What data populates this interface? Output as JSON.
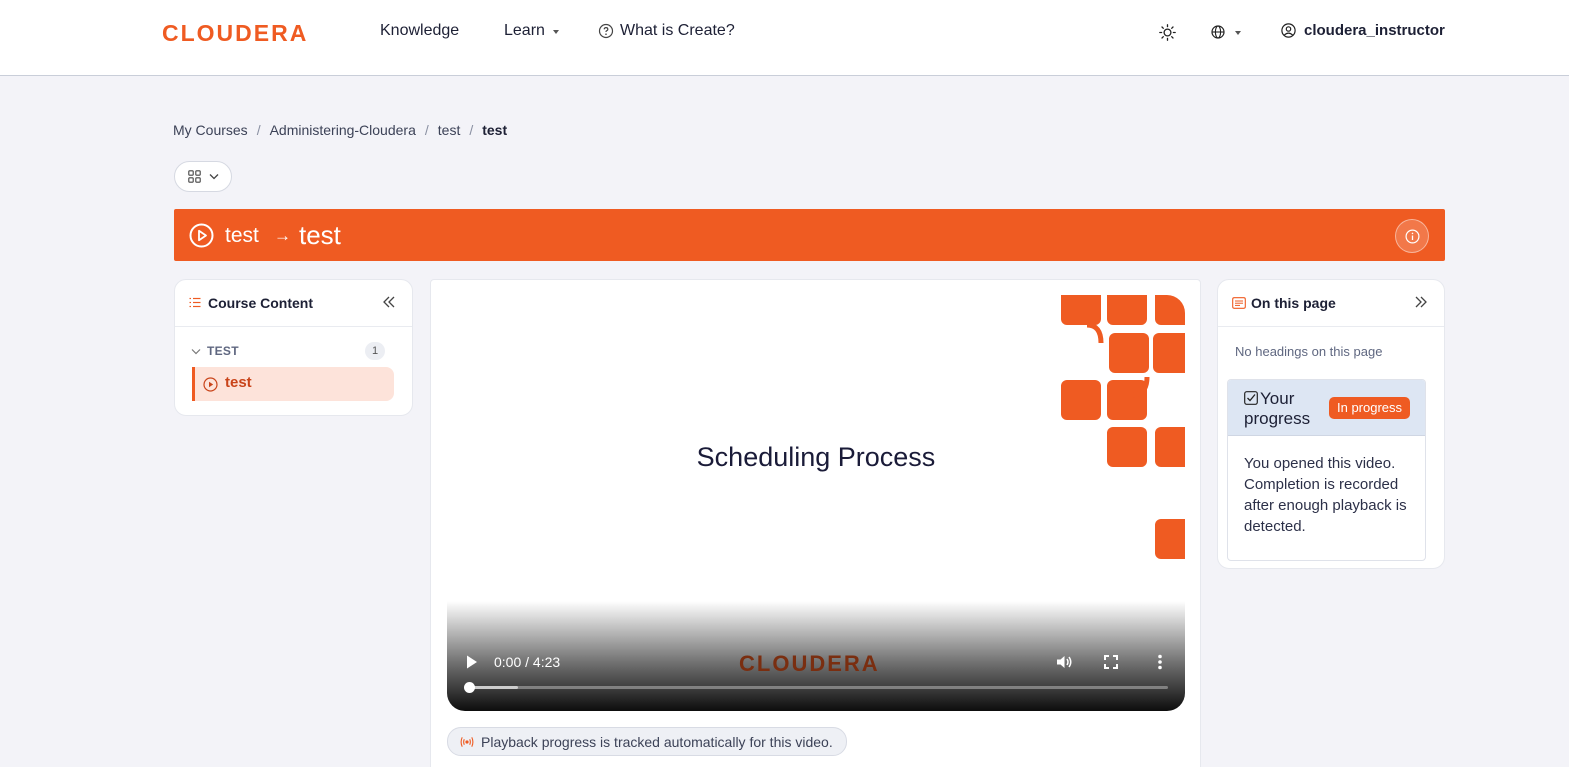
{
  "header": {
    "logo_text": "CLOUDERA",
    "nav": {
      "knowledge": "Knowledge",
      "learn": "Learn",
      "what_is_create": "What is Create?"
    },
    "user": "cloudera_instructor"
  },
  "breadcrumb": {
    "items": [
      "My Courses",
      "Administering-Cloudera",
      "test"
    ],
    "current": "test",
    "separator": "/"
  },
  "banner": {
    "parent": "test",
    "arrow": "→",
    "title": "test",
    "color": "#ef5b22"
  },
  "course_content": {
    "title": "Course Content",
    "section": {
      "label": "TEST",
      "count": "1"
    },
    "lesson": "test"
  },
  "video": {
    "title": "Scheduling Process",
    "time": "0:00 / 4:23",
    "watermark": "CLOUDERA",
    "progress_fraction": 0,
    "buffered_fraction": 0.07
  },
  "playback_note": "Playback progress is tracked automatically for this video.",
  "on_this_page": {
    "title": "On this page",
    "empty": "No headings on this page",
    "progress": {
      "label": "Your progress",
      "status": "In progress",
      "message": "You opened this video. Completion is recorded after enough playback is detected."
    }
  },
  "colors": {
    "accent": "#ef5b22",
    "background": "#f3f3f8",
    "lesson_active": "#fde3da",
    "progress_header": "#dde6f3"
  }
}
